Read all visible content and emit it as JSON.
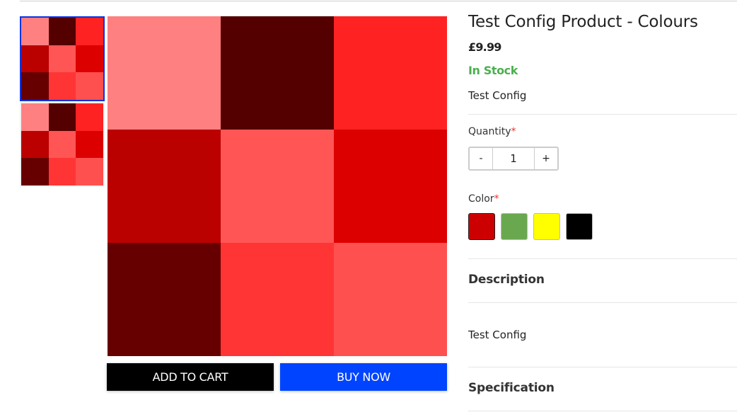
{
  "gallery": {
    "tile_colors": [
      "#ff8080",
      "#550000",
      "#ff2222",
      "#bb0000",
      "#ff5555",
      "#dd0000",
      "#660000",
      "#ff3535",
      "#ff5050"
    ],
    "thumbnails": [
      {
        "label": "thumbnail-1",
        "selected": true
      },
      {
        "label": "thumbnail-2",
        "selected": false
      }
    ]
  },
  "buttons": {
    "add_to_cart": "ADD TO CART",
    "buy_now": "BUY NOW"
  },
  "product": {
    "title": "Test Config Product - Colours",
    "price": "£9.99",
    "stock_status": "In Stock",
    "short_description": "Test Config",
    "stock_color": "#4caf50"
  },
  "quantity": {
    "label": "Quantity",
    "required_mark": "*",
    "minus": "-",
    "value": "1",
    "plus": "+"
  },
  "color": {
    "label": "Color",
    "required_mark": "*",
    "options": [
      {
        "name": "red",
        "hex": "#cc0000",
        "selected": true
      },
      {
        "name": "green",
        "hex": "#6aa84f",
        "selected": false
      },
      {
        "name": "yellow",
        "hex": "#ffff00",
        "selected": false
      },
      {
        "name": "black",
        "hex": "#000000",
        "selected": false
      }
    ]
  },
  "sections": {
    "description": {
      "heading": "Description",
      "body": "Test Config"
    },
    "specification": {
      "heading": "Specification"
    }
  }
}
